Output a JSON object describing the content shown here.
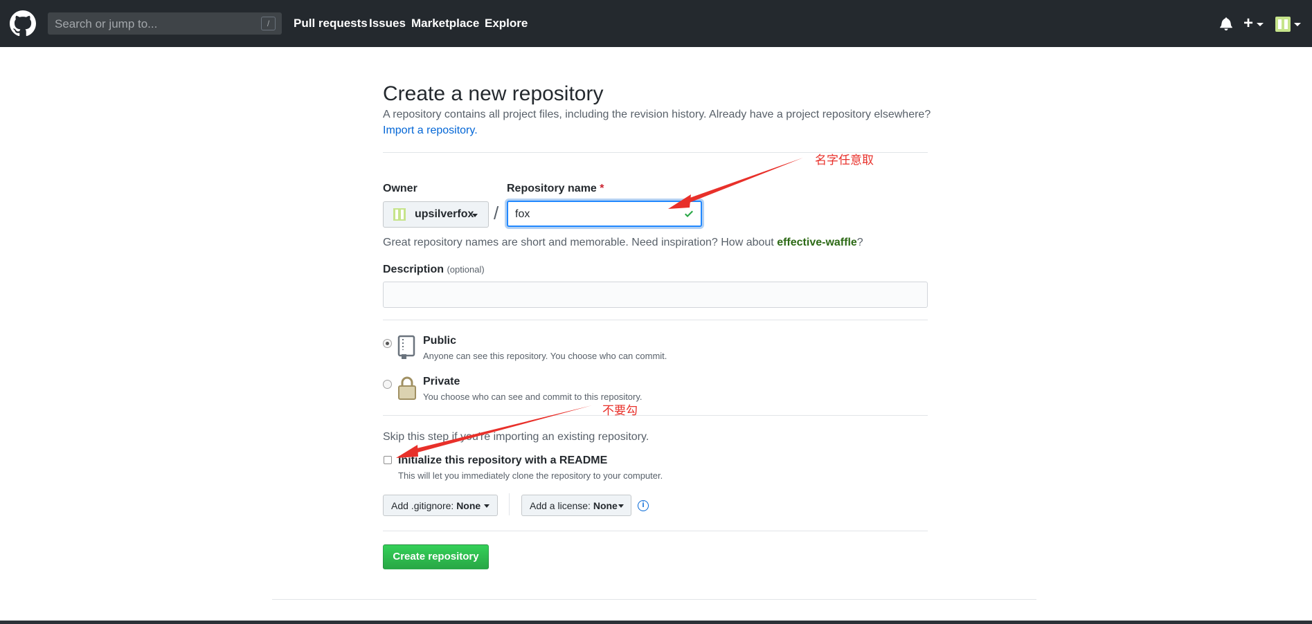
{
  "header": {
    "search_placeholder": "Search or jump to...",
    "search_shortcut": "/",
    "nav": [
      "Pull requests",
      "Issues",
      "Marketplace",
      "Explore"
    ],
    "plus_icon": "+"
  },
  "page": {
    "title": "Create a new repository",
    "subtitle": "A repository contains all project files, including the revision history. Already have a project repository elsewhere?",
    "import_link": "Import a repository.",
    "owner_label": "Owner",
    "owner_value": "upsilverfox",
    "separator": "/",
    "repo_label": "Repository name",
    "required_mark": "*",
    "repo_value": "fox",
    "hint_prefix": "Great repository names are short and memorable. Need inspiration? How about ",
    "hint_suggestion": "effective-waffle",
    "hint_suffix": "?",
    "desc_label": "Description",
    "desc_optional": "(optional)",
    "desc_value": "",
    "visibility": [
      {
        "title": "Public",
        "note": "Anyone can see this repository. You choose who can commit.",
        "selected": true
      },
      {
        "title": "Private",
        "note": "You choose who can see and commit to this repository.",
        "selected": false
      }
    ],
    "skip_text": "Skip this step if you're importing an existing repository.",
    "readme_label": "Initialize this repository with a README",
    "readme_note": "This will let you immediately clone the repository to your computer.",
    "gitignore_prefix": "Add .gitignore:",
    "gitignore_value": "None",
    "license_prefix": "Add a license:",
    "license_value": "None",
    "info_icon": "i",
    "create_button": "Create repository"
  },
  "annotations": {
    "name_note": "名字任意取",
    "readme_note": "不要勾"
  },
  "colors": {
    "header_bg": "#24292e",
    "link": "#0366d6",
    "create_button": "#28a745",
    "annotation": "#e8302a"
  }
}
